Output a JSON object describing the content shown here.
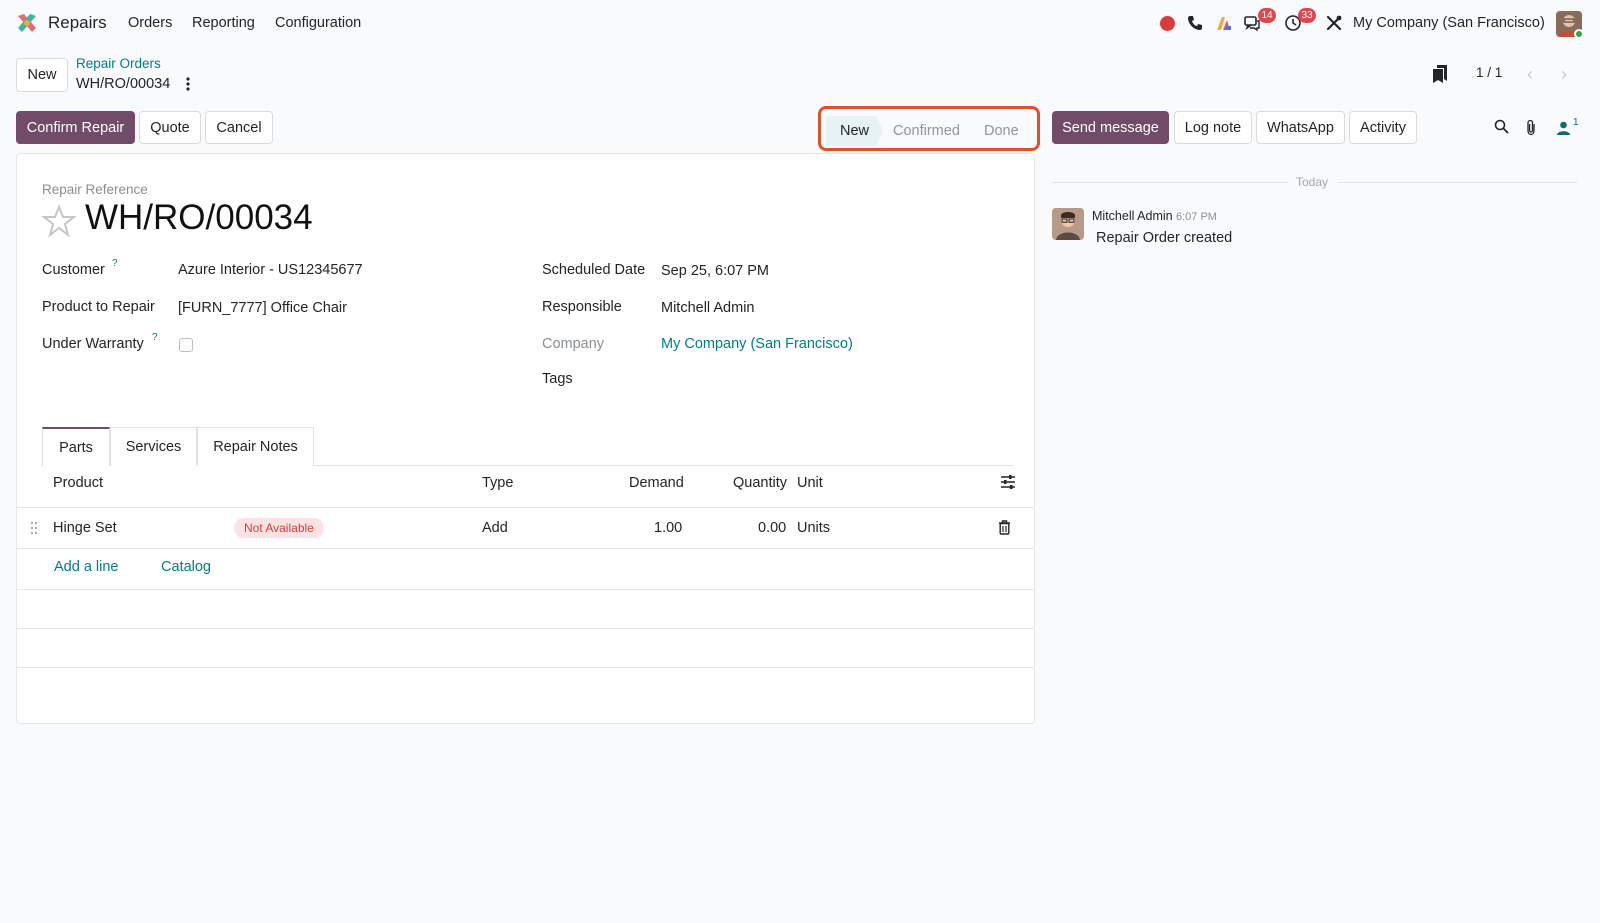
{
  "navbar": {
    "app_name": "Repairs",
    "menus": [
      "Orders",
      "Reporting",
      "Configuration"
    ],
    "messages_badge": "14",
    "activities_badge": "33",
    "company": "My Company (San Francisco)"
  },
  "control_panel": {
    "new_button": "New",
    "breadcrumb_parent": "Repair Orders",
    "record_name": "WH/RO/00034",
    "pager_value": "1 / 1"
  },
  "actions": {
    "confirm": "Confirm Repair",
    "quote": "Quote",
    "cancel": "Cancel"
  },
  "statusbar": {
    "steps": [
      "New",
      "Confirmed",
      "Done"
    ],
    "current": "New"
  },
  "form": {
    "reference_label": "Repair Reference",
    "reference": "WH/RO/00034",
    "customer_label": "Customer",
    "customer": "Azure Interior - US12345677",
    "product_label": "Product to Repair",
    "product": "[FURN_7777] Office Chair",
    "warranty_label": "Under Warranty",
    "help_mark": "?",
    "scheduled_label": "Scheduled Date",
    "scheduled": "Sep 25, 6:07 PM",
    "responsible_label": "Responsible",
    "responsible": "Mitchell Admin",
    "company_label": "Company",
    "company": "My Company (San Francisco)",
    "tags_label": "Tags"
  },
  "tabs": [
    "Parts",
    "Services",
    "Repair Notes"
  ],
  "parts_table": {
    "headers": {
      "product": "Product",
      "type": "Type",
      "demand": "Demand",
      "quantity": "Quantity",
      "unit": "Unit"
    },
    "rows": [
      {
        "product": "Hinge Set",
        "availability": "Not Available",
        "type": "Add",
        "demand": "1.00",
        "quantity": "0.00",
        "unit": "Units"
      }
    ],
    "add_line": "Add a line",
    "catalog": "Catalog"
  },
  "chatter": {
    "send_message": "Send message",
    "log_note": "Log note",
    "whatsapp": "WhatsApp",
    "activity": "Activity",
    "followers_count": "1",
    "date_separator": "Today",
    "messages": [
      {
        "author": "Mitchell Admin",
        "time": "6:07 PM",
        "body": "Repair Order created"
      }
    ]
  },
  "colors": {
    "brand": "#714b67",
    "link": "#017e84",
    "highlight_frame": "#d9532c",
    "badge": "#e0464f"
  }
}
